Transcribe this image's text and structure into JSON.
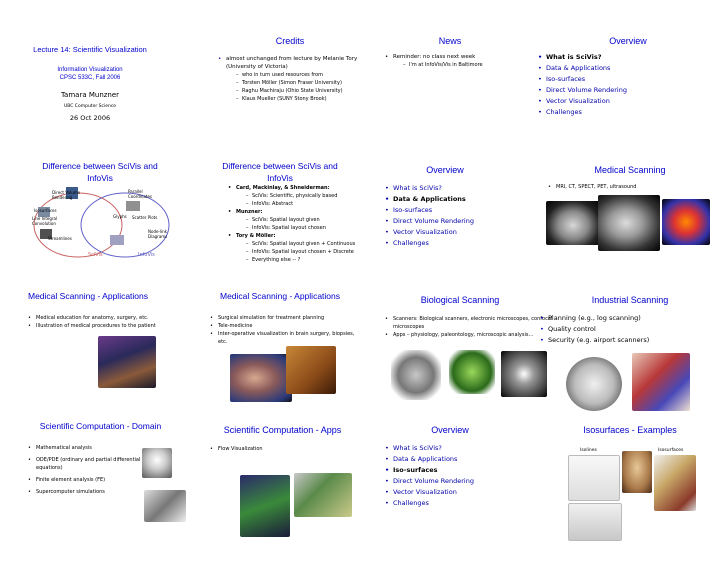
{
  "s1": {
    "lines": [
      "Lecture 14: Scientific Visualization",
      "Information Visualization",
      "CPSC 533C, Fall 2006",
      "Tamara Munzner",
      "UBC Computer Science",
      "26 Oct 2006"
    ]
  },
  "s2": {
    "title": "Credits",
    "b1": "almost unchanged from lecture by Melanie Tory (University of Victoria)",
    "subs": [
      "who in turn used resources from",
      "Torsten Möller (Simon Fraser University)",
      "Raghu Machiraju (Ohio State University)",
      "Klaus Mueller (SUNY Stony Brook)"
    ]
  },
  "s3": {
    "title": "News",
    "b1": "Reminder: no class next week",
    "sub": "I'm at InfoVis/Vis in Baltimore"
  },
  "overview_items": [
    "What is SciVis?",
    "Data & Applications",
    "Iso-surfaces",
    "Direct Volume Rendering",
    "Vector Visualization",
    "Challenges"
  ],
  "s4": {
    "title": "Overview"
  },
  "s5": {
    "title": "Difference between SciVis and InfoVis",
    "labels": [
      "Direct Volume Rendering",
      "Parallel Coordinates",
      "Isosurfaces",
      "Glyphs",
      "Scatter Plots",
      "Line Integral Convolution",
      "Streamlines",
      "Node-link Diagrams",
      "SciVis",
      "InfoVis"
    ]
  },
  "s6": {
    "title": "Difference between SciVis and InfoVis",
    "b1": "Card, Mackinlay, & Shneiderman:",
    "b1s": [
      "SciVis:  Scientific, physically based",
      "InfoVis: Abstract"
    ],
    "b2": "Munzner:",
    "b2s": [
      "SciVis:   Spatial layout given",
      "InfoVis:  Spatial layout chosen"
    ],
    "b3": "Tory & Möller:",
    "b3s": [
      "SciVis:  Spatial layout given + Continuous",
      "InfoVis: Spatial layout chosen + Discrete",
      "Everything else -- ?"
    ]
  },
  "s7": {
    "title": "Overview"
  },
  "s8": {
    "title": "Medical Scanning",
    "b1": "MRI, CT, SPECT, PET, ultrasound"
  },
  "s9": {
    "title": "Medical Scanning - Applications",
    "items": [
      "Medical education for anatomy, surgery, etc.",
      "Illustration of medical procedures to the patient"
    ]
  },
  "s10": {
    "title": "Medical Scanning - Applications",
    "items": [
      "Surgical simulation for treatment planning",
      "Tele-medicine",
      "Inter-operative visualization in brain surgery, biopsies, etc."
    ]
  },
  "s11": {
    "title": "Biological Scanning",
    "items": [
      "Scanners: Biological scanners, electronic microscopes, confocal microscopes",
      "Apps – physiology, paleontology, microscopic analysis…"
    ]
  },
  "s12": {
    "title": "Industrial Scanning",
    "items": [
      "Planning (e.g., log scanning)",
      "Quality control",
      "Security (e.g. airport scanners)"
    ]
  },
  "s13": {
    "title": "Scientific Computation - Domain",
    "items": [
      "Mathematical analysis",
      "ODE/PDE (ordinary and partial differential equations)",
      "Finite element analysis (FE)",
      "Supercomputer simulations"
    ]
  },
  "s14": {
    "title": "Scientific Computation - Apps",
    "items": [
      "Flow Visualization"
    ]
  },
  "s15": {
    "title": "Overview"
  },
  "s16": {
    "title": "Isosurfaces - Examples",
    "labels": [
      "Isolines",
      "Isosurfaces"
    ]
  }
}
